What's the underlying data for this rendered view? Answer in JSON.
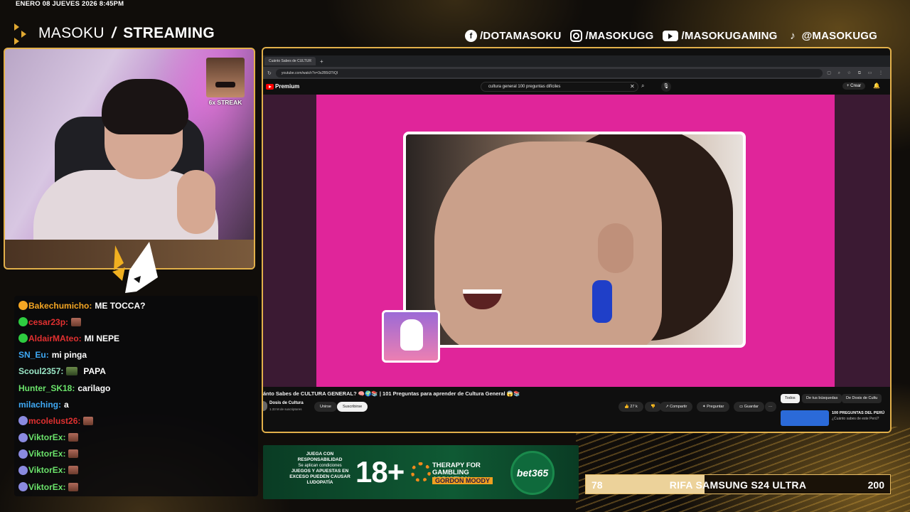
{
  "overlay": {
    "datetime": "ENERO 08 JUEVES 2026 8:45PM",
    "brand_name": "MASOKU",
    "brand_sep": "/",
    "brand_sub": "STREAMING",
    "socials": [
      {
        "icon": "facebook-icon",
        "label": "/DOTAMASOKU"
      },
      {
        "icon": "instagram-icon",
        "label": "/MASOKUGG"
      },
      {
        "icon": "youtube-icon",
        "label": "/MASOKUGAMING"
      },
      {
        "icon": "tiktok-icon",
        "label": "@MASOKUGG"
      }
    ],
    "streak_label": "6x STREAK",
    "accent": "#e2b04a"
  },
  "chat": [
    {
      "user": "Bakechumicho",
      "color": "#f5a623",
      "badge": "#f5a623",
      "message": "ME TOCCA?",
      "emote": false
    },
    {
      "user": "cesar23p",
      "color": "#e03030",
      "badge": "#2ecc40",
      "message": "",
      "emote": true
    },
    {
      "user": "AldairMAteo",
      "color": "#e03030",
      "badge": "#2ecc40",
      "message": "MI NEPE",
      "emote": false
    },
    {
      "user": "SN_Eu",
      "color": "#3fa9f5",
      "badge": "",
      "message": "mi pinga",
      "emote": false
    },
    {
      "user": "Scoul2357",
      "color": "#9be8c8",
      "badge": "",
      "message": "PAPA",
      "emote": true
    },
    {
      "user": "Hunter_SK18",
      "color": "#6be36b",
      "badge": "",
      "message": "carilago",
      "emote": false
    },
    {
      "user": "milaching",
      "color": "#3fa9f5",
      "badge": "",
      "message": "a",
      "emote": false
    },
    {
      "user": "mcolelust26",
      "color": "#e03030",
      "badge": "#8a8ae0",
      "message": "",
      "emote": true
    },
    {
      "user": "ViktorEx",
      "color": "#6be36b",
      "badge": "#8a8ae0",
      "message": "",
      "emote": true
    },
    {
      "user": "ViktorEx",
      "color": "#6be36b",
      "badge": "#8a8ae0",
      "message": "",
      "emote": true
    },
    {
      "user": "ViktorEx",
      "color": "#6be36b",
      "badge": "#8a8ae0",
      "message": "",
      "emote": true
    },
    {
      "user": "ViktorEx",
      "color": "#6be36b",
      "badge": "#8a8ae0",
      "message": "",
      "emote": true
    }
  ],
  "browser": {
    "tab_title": "Cuánto Sabes de CULTUR",
    "url": "youtube.com/watch?v=3s2B5t3TtQI",
    "yt_logo": "Premium",
    "search_query": "cultura general 100 preguntas difíciles",
    "create_label": "+ Crear",
    "video_title": "ánto Sabes de CULTURA GENERAL? 🧠🌍📚 | 101 Preguntas para aprender de Cultura General 😱📚",
    "channel_name": "Dosis de Cultura",
    "channel_subs": "1.33 M de suscriptores",
    "join_label": "Unirse",
    "subscribed_label": "Suscribirse",
    "likes": "27 k",
    "share_label": "Compartir",
    "ask_label": "Preguntar",
    "save_label": "Guardar",
    "more_label": "···",
    "chips": [
      "Todos",
      "De tus búsquedas",
      "De Dosis de Cultu"
    ],
    "related_title": "100 PREGUNTAS DEL PERÚ",
    "related_sub": "¿Cuánto sabes de este Perú?"
  },
  "ad": {
    "line1": "JUEGA CON RESPONSABILIDAD",
    "line2": "Se aplican condiciones",
    "line3": "JUEGOS Y APUESTAS EN EXCESO PUEDEN CAUSAR LUDOPATÍA",
    "age": "18+",
    "therapy": "THERAPY FOR GAMBLING ADDICTION",
    "gordon": "GORDON MOODY",
    "brand": "bet365"
  },
  "raffle": {
    "current": "78",
    "title": "RIFA SAMSUNG S24 ULTRA",
    "goal": "200",
    "progress": 0.39
  }
}
